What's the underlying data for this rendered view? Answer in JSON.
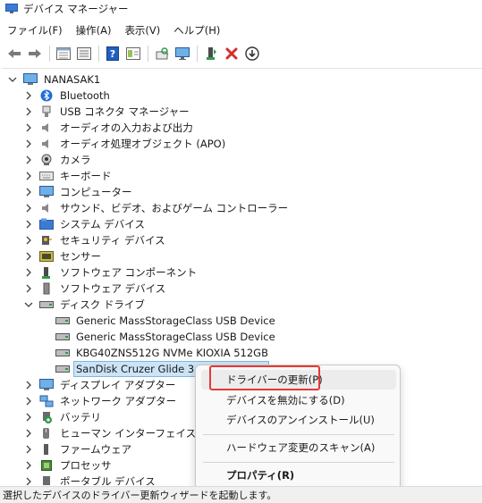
{
  "window": {
    "title": "デバイス マネージャー"
  },
  "menubar": {
    "items": [
      "ファイル(F)",
      "操作(A)",
      "表示(V)",
      "ヘルプ(H)"
    ]
  },
  "toolbar": {
    "buttons": [
      "back-arrow-icon",
      "forward-arrow-icon",
      "properties-grid-icon",
      "update-list-icon",
      "help-icon",
      "panel-icon",
      "scan-hardware-icon",
      "monitor-icon",
      "add-driver-icon",
      "remove-x-icon",
      "download-circle-icon"
    ],
    "colors": {
      "remove": "#d32f2f",
      "help": "#1f5fbf"
    }
  },
  "tree": {
    "root": "NANASAK1",
    "categories": {
      "bluetooth": "Bluetooth",
      "usb_connector": "USB コネクタ マネージャー",
      "audio_io": "オーディオの入力および出力",
      "audio_apo": "オーディオ処理オブジェクト (APO)",
      "camera": "カメラ",
      "keyboard": "キーボード",
      "computer": "コンピューター",
      "sound": "サウンド、ビデオ、およびゲーム コントローラー",
      "system": "システム デバイス",
      "security": "セキュリティ デバイス",
      "sensor": "センサー",
      "sw_component": "ソフトウェア コンポーネント",
      "sw_device": "ソフトウェア デバイス",
      "disk": "ディスク ドライブ",
      "display": "ディスプレイ アダプター",
      "network": "ネットワーク アダプター",
      "battery": "バッテリ",
      "hid": "ヒューマン インターフェイス デバイス",
      "firmware": "ファームウェア",
      "processor": "プロセッサ",
      "portable": "ポータブル デバイス"
    },
    "disk_children": [
      "Generic MassStorageClass USB Device",
      "Generic MassStorageClass USB Device",
      "KBG40ZNS512G NVMe KIOXIA 512GB",
      "SanDisk Cruzer Glide 3.0 USB Device"
    ]
  },
  "context_menu": {
    "update_driver": "ドライバーの更新(P)",
    "disable_device": "デバイスを無効にする(D)",
    "uninstall_device": "デバイスのアンインストール(U)",
    "scan_hardware": "ハードウェア変更のスキャン(A)",
    "properties": "プロパティ(R)",
    "highlight_color": "#e53935"
  },
  "statusbar": {
    "text": "選択したデバイスのドライバー更新ウィザードを起動します。"
  }
}
